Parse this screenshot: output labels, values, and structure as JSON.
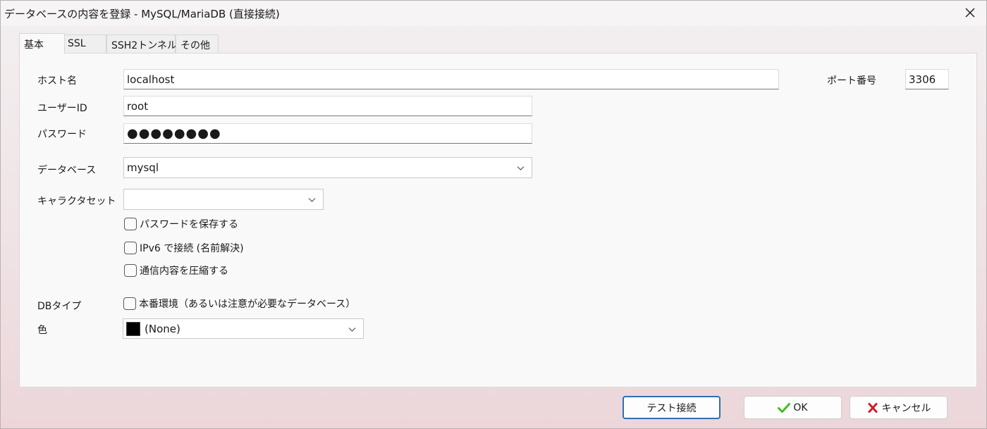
{
  "window": {
    "title": "データベースの内容を登録 - MySQL/MariaDB (直接接続)"
  },
  "tabs": [
    {
      "label": "基本",
      "active": true
    },
    {
      "label": "SSL",
      "active": false
    },
    {
      "label": "SSH2トンネル",
      "active": false
    },
    {
      "label": "その他",
      "active": false
    }
  ],
  "form": {
    "host_label": "ホスト名",
    "host_value": "localhost",
    "port_label": "ポート番号",
    "port_value": "3306",
    "user_label": "ユーザーID",
    "user_value": "root",
    "password_label": "パスワード",
    "password_value": "●●●●●●●●",
    "database_label": "データベース",
    "database_value": "mysql",
    "charset_label": "キャラクタセット",
    "charset_value": "",
    "save_password_label": "パスワードを保存する",
    "ipv6_label": "IPv6 で接続 (名前解決)",
    "compress_label": "通信内容を圧縮する",
    "dbtype_label": "DBタイプ",
    "production_label": "本番環境（あるいは注意が必要なデータベース）",
    "color_label": "色",
    "color_value": "(None)",
    "color_swatch": "#000000"
  },
  "buttons": {
    "test_label": "テスト接続",
    "ok_label": "OK",
    "cancel_label": "キャンセル"
  },
  "icons": {
    "close": "close-icon",
    "chevron": "chevron-down-icon",
    "ok": "checkmark-icon",
    "cancel": "x-mark-icon"
  },
  "colors": {
    "ok_check": "#3fbf1f",
    "cancel_x": "#d11a2a",
    "focus_border": "#2f6fb3"
  }
}
